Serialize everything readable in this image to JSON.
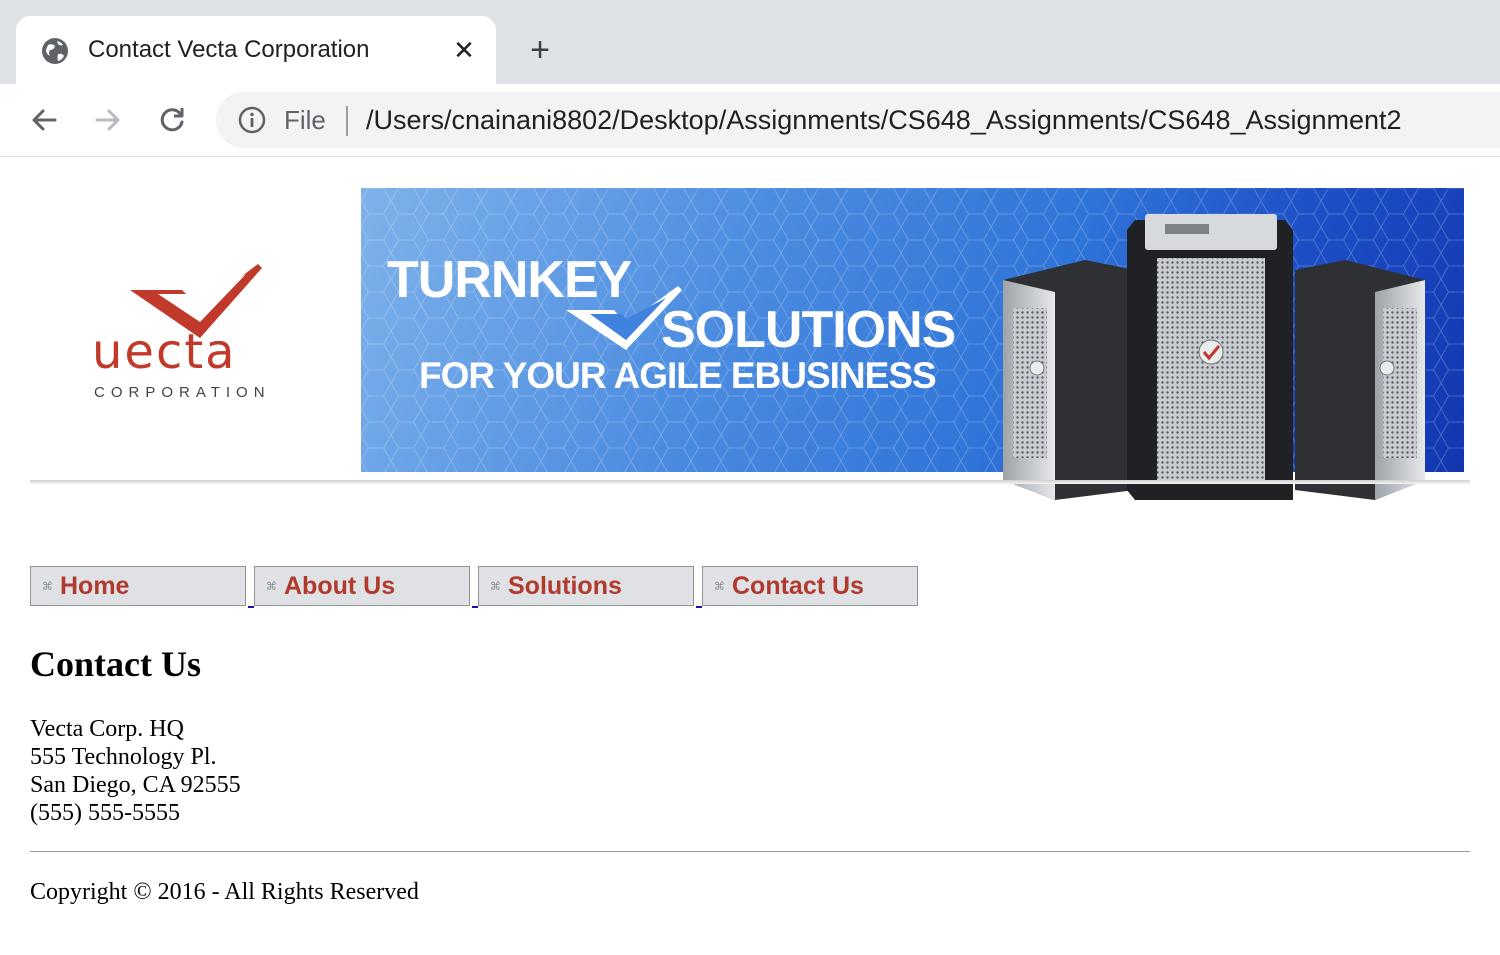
{
  "browser": {
    "tab_title": "Contact Vecta Corporation",
    "omnibox_scheme_label": "File",
    "url": "/Users/cnainani8802/Desktop/Assignments/CS648_Assignments/CS648_Assignment2"
  },
  "logo": {
    "wordmark": "uecta",
    "subtitle": "CORPORATION",
    "color": "#c0392b"
  },
  "banner": {
    "line1": "TURNKEY",
    "line2": "SOLUTIONS",
    "line3": "FOR YOUR AGILE EBUSINESS"
  },
  "nav": {
    "items": [
      {
        "label": "Home"
      },
      {
        "label": "About Us"
      },
      {
        "label": "Solutions"
      },
      {
        "label": "Contact Us"
      }
    ],
    "label_color": "#b03a2e"
  },
  "main": {
    "heading": "Contact Us",
    "address": {
      "line1": "Vecta Corp. HQ",
      "line2": "555 Technology Pl.",
      "line3": "San Diego, CA 92555",
      "phone": "(555) 555-5555"
    }
  },
  "footer": {
    "copyright": "Copyright © 2016 - All Rights Reserved"
  }
}
